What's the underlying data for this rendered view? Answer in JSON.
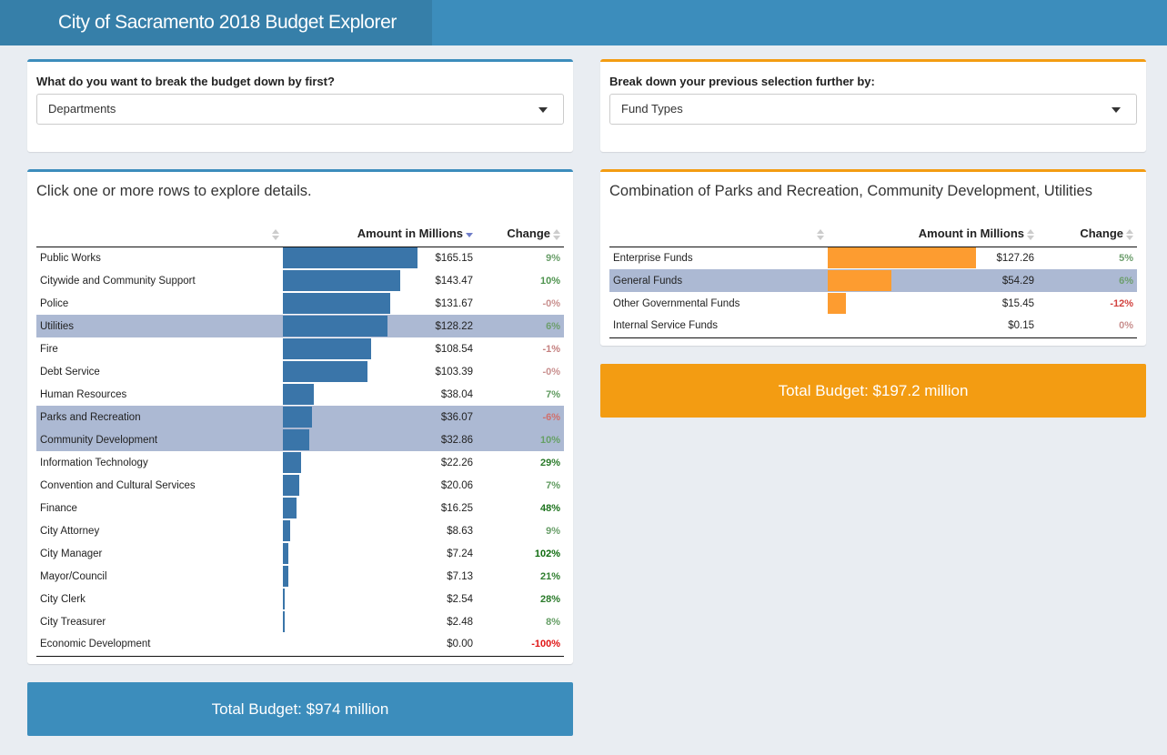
{
  "app": {
    "title": "City of Sacramento 2018 Budget Explorer"
  },
  "colors": {
    "header": "#3c8dbc",
    "brand": "#367fa9",
    "accent_blue": "#3c8dbc",
    "accent_orange": "#f39c12",
    "bar_blue": "#3a75a9",
    "bar_orange": "#fd9c30",
    "selected_row": "#acb9d3"
  },
  "left_select": {
    "label": "What do you want to break the budget down by first?",
    "value": "Departments"
  },
  "right_select": {
    "label": "Break down your previous selection further by:",
    "value": "Fund Types"
  },
  "left_table": {
    "title": "Click one or more rows to explore details.",
    "col_amount": "Amount in Millions",
    "col_change": "Change",
    "rows": [
      {
        "name": "Public Works",
        "amount": "$165.15",
        "value": 165.15,
        "change": "9%",
        "color": "#6a9f6a",
        "selected": false
      },
      {
        "name": "Citywide and Community Support",
        "amount": "$143.47",
        "value": 143.47,
        "change": "10%",
        "color": "#4e934e",
        "selected": false
      },
      {
        "name": "Police",
        "amount": "$131.67",
        "value": 131.67,
        "change": "-0%",
        "color": "#c9908f",
        "selected": false
      },
      {
        "name": "Utilities",
        "amount": "$128.22",
        "value": 128.22,
        "change": "6%",
        "color": "#6d9e6d",
        "selected": true
      },
      {
        "name": "Fire",
        "amount": "$108.54",
        "value": 108.54,
        "change": "-1%",
        "color": "#c58180",
        "selected": false
      },
      {
        "name": "Debt Service",
        "amount": "$103.39",
        "value": 103.39,
        "change": "-0%",
        "color": "#c9908f",
        "selected": false
      },
      {
        "name": "Human Resources",
        "amount": "$38.04",
        "value": 38.04,
        "change": "7%",
        "color": "#5f9a5f",
        "selected": false
      },
      {
        "name": "Parks and Recreation",
        "amount": "$36.07",
        "value": 36.07,
        "change": "-6%",
        "color": "#d0706d",
        "selected": true
      },
      {
        "name": "Community Development",
        "amount": "$32.86",
        "value": 32.86,
        "change": "10%",
        "color": "#66a066",
        "selected": true
      },
      {
        "name": "Information Technology",
        "amount": "$22.26",
        "value": 22.26,
        "change": "29%",
        "color": "#2a7a2a",
        "selected": false
      },
      {
        "name": "Convention and Cultural Services",
        "amount": "$20.06",
        "value": 20.06,
        "change": "7%",
        "color": "#5f9a5f",
        "selected": false
      },
      {
        "name": "Finance",
        "amount": "$16.25",
        "value": 16.25,
        "change": "48%",
        "color": "#1d731d",
        "selected": false
      },
      {
        "name": "City Attorney",
        "amount": "$8.63",
        "value": 8.63,
        "change": "9%",
        "color": "#6a9f6a",
        "selected": false
      },
      {
        "name": "City Manager",
        "amount": "$7.24",
        "value": 7.24,
        "change": "102%",
        "color": "#0f6b0f",
        "selected": false
      },
      {
        "name": "Mayor/Council",
        "amount": "$7.13",
        "value": 7.13,
        "change": "21%",
        "color": "#2f7e2f",
        "selected": false
      },
      {
        "name": "City Clerk",
        "amount": "$2.54",
        "value": 2.54,
        "change": "28%",
        "color": "#2a7a2a",
        "selected": false
      },
      {
        "name": "City Treasurer",
        "amount": "$2.48",
        "value": 2.48,
        "change": "8%",
        "color": "#659e65",
        "selected": false
      },
      {
        "name": "Economic Development",
        "amount": "$0.00",
        "value": 0.0,
        "change": "-100%",
        "color": "#e01414",
        "selected": false
      }
    ]
  },
  "right_table": {
    "title": "Combination of Parks and Recreation, Community Development, Utilities",
    "col_amount": "Amount in Millions",
    "col_change": "Change",
    "rows": [
      {
        "name": "Enterprise Funds",
        "amount": "$127.26",
        "value": 127.26,
        "change": "5%",
        "color": "#6d9e6d",
        "selected": false
      },
      {
        "name": "General Funds",
        "amount": "$54.29",
        "value": 54.29,
        "change": "6%",
        "color": "#6d9e6d",
        "selected": true
      },
      {
        "name": "Other Governmental Funds",
        "amount": "$15.45",
        "value": 15.45,
        "change": "-12%",
        "color": "#d2423f",
        "selected": false
      },
      {
        "name": "Internal Service Funds",
        "amount": "$0.15",
        "value": 0.15,
        "change": "0%",
        "color": "#c9908f",
        "selected": false
      }
    ]
  },
  "totals": {
    "left": "Total Budget: $974 million",
    "right": "Total Budget: $197.2 million"
  }
}
